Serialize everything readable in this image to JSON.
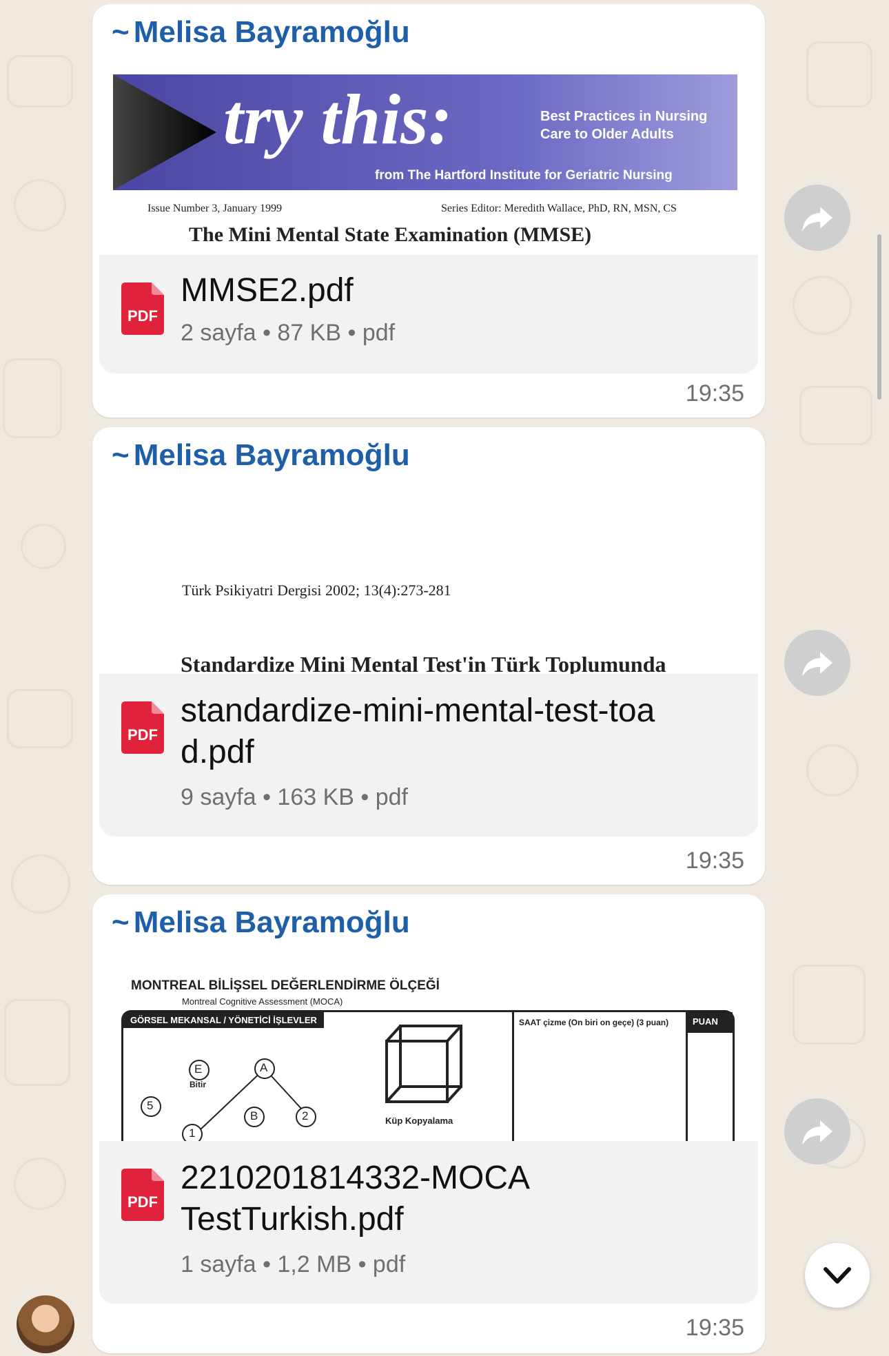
{
  "messages": [
    {
      "sender": "Melisa Bayramoğlu",
      "preview": {
        "banner_title": "try this:",
        "banner_subtitle": "Best Practices in Nursing Care to Older Adults",
        "banner_from": "from The Hartford Institute for Geriatric Nursing",
        "issue": "Issue Number 3, January 1999",
        "editor": "Series Editor: Meredith Wallace, PhD, RN, MSN, CS",
        "heading": "The Mini Mental State Examination (MMSE)"
      },
      "file_name": "MMSE2.pdf",
      "file_meta": "2 sayfa • 87 KB • pdf",
      "time": "19:35"
    },
    {
      "sender": "Melisa Bayramoğlu",
      "preview": {
        "journal": "Türk Psikiyatri Dergisi 2002; 13(4):273-281",
        "heading": "Standardize Mini Mental Test'in Türk Toplumunda"
      },
      "file_name": "standardize-mini-mental-test-toad.pdf",
      "file_meta": "9 sayfa • 163 KB • pdf",
      "time": "19:35"
    },
    {
      "sender": "Melisa Bayramoğlu",
      "preview": {
        "title": "MONTREAL BİLİŞSEL DEĞERLENDİRME ÖLÇEĞİ",
        "subtitle": "Montreal Cognitive Assessment (MOCA)",
        "section": "GÖRSEL MEKANSAL / YÖNETİCİ İŞLEVLER",
        "cube_label": "Küp Kopyalama",
        "clock_label": "SAAT çizme (On biri on geçe) (3 puan)",
        "score_label": "PUAN",
        "trail_nodes": [
          "E",
          "A",
          "5",
          "B",
          "2",
          "1"
        ],
        "bitir": "Bitir"
      },
      "file_name": "2210201814332-MOCATestTurkish.pdf",
      "file_meta": "1 sayfa • 1,2 MB • pdf",
      "time": "19:35"
    }
  ],
  "pdf_badge": "PDF",
  "icons": {
    "forward": "forward-arrow-icon",
    "scroll_down": "chevron-down-icon",
    "file": "pdf-file-icon"
  },
  "colors": {
    "sender": "#1f5fa8",
    "pdf_red": "#e0223b",
    "wallpaper": "#efe9df"
  }
}
